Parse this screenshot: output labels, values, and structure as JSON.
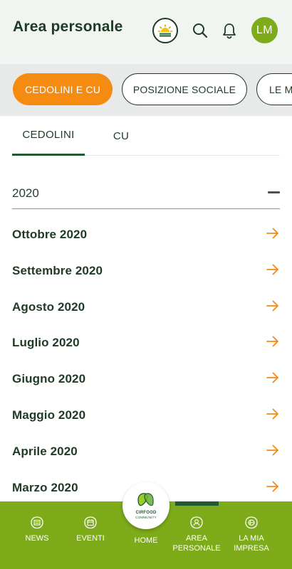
{
  "header": {
    "title": "Area personale",
    "avatar_initials": "LM",
    "icons": [
      "sunrise-icon",
      "search-icon",
      "bell-icon"
    ]
  },
  "chips": [
    {
      "label": "CEDOLINI E CU",
      "active": true
    },
    {
      "label": "POSIZIONE SOCIALE",
      "active": false
    },
    {
      "label": "LE M",
      "active": false
    }
  ],
  "tabs": [
    {
      "label": "CEDOLINI",
      "active": true
    },
    {
      "label": "CU",
      "active": false
    }
  ],
  "year": {
    "label": "2020",
    "expanded": true
  },
  "months": [
    {
      "label": "Ottobre 2020"
    },
    {
      "label": "Settembre 2020"
    },
    {
      "label": "Agosto 2020"
    },
    {
      "label": "Luglio 2020"
    },
    {
      "label": "Giugno 2020"
    },
    {
      "label": "Maggio 2020"
    },
    {
      "label": "Aprile 2020"
    },
    {
      "label": "Marzo 2020"
    }
  ],
  "bottom_nav": {
    "news": "NEWS",
    "eventi": "EVENTI",
    "home": "HOME",
    "area_line1": "AREA",
    "area_line2": "PERSONALE",
    "impresa_line1": "LA MIA",
    "impresa_line2": "IMPRESA",
    "logo_line1": "CIRFOOD",
    "logo_line2": "COMMUNITY",
    "active": "area"
  },
  "colors": {
    "accent_orange": "#f68b12",
    "brand_green": "#7dab1a",
    "dark_green": "#1f3a26"
  }
}
